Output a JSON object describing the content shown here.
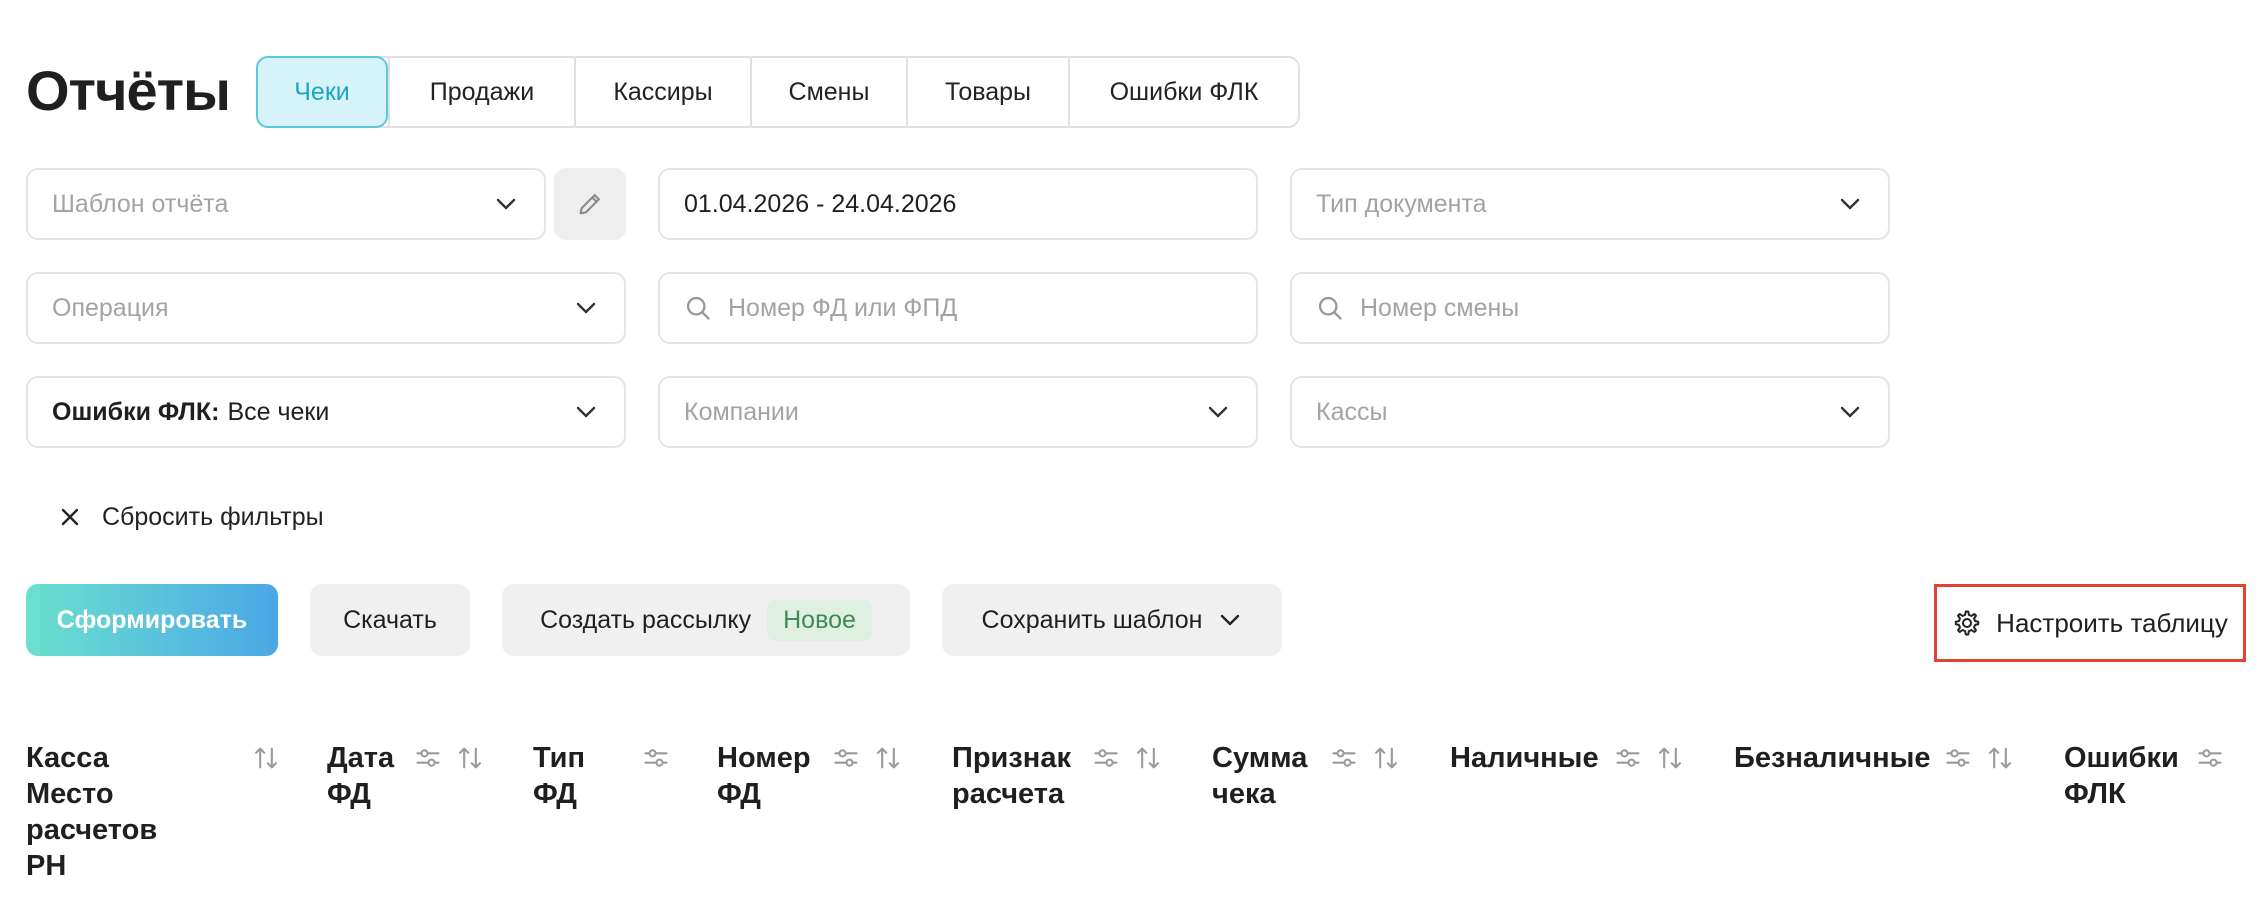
{
  "page_title": "Отчёты",
  "tabs": [
    {
      "label": "Чеки",
      "active": true
    },
    {
      "label": "Продажи"
    },
    {
      "label": "Кассиры"
    },
    {
      "label": "Смены"
    },
    {
      "label": "Товары"
    },
    {
      "label": "Ошибки ФЛК"
    }
  ],
  "filters": {
    "template_placeholder": "Шаблон отчёта",
    "date_range": "01.04.2026 - 24.04.2026",
    "doc_type_placeholder": "Тип документа",
    "operation_placeholder": "Операция",
    "fd_number_placeholder": "Номер ФД или ФПД",
    "shift_number_placeholder": "Номер смены",
    "flk_errors_label": "Ошибки ФЛК:",
    "flk_errors_value": "Все чеки",
    "companies_placeholder": "Компании",
    "cashboxes_placeholder": "Кассы",
    "reset_label": "Сбросить фильтры"
  },
  "actions": {
    "generate": "Сформировать",
    "download": "Скачать",
    "create_mailing": "Создать рассылку",
    "new_badge": "Новое",
    "save_template": "Сохранить шаблон",
    "configure_table": "Настроить таблицу"
  },
  "table": {
    "columns": [
      {
        "label": "Касса\nМесто\nрасчетов\nРН",
        "filter": false,
        "sort": true
      },
      {
        "label": "Дата\nФД",
        "filter": true,
        "sort": true
      },
      {
        "label": "Тип\nФД",
        "filter": true,
        "sort": false
      },
      {
        "label": "Номер\nФД",
        "filter": true,
        "sort": true
      },
      {
        "label": "Признак\nрасчета",
        "filter": true,
        "sort": true
      },
      {
        "label": "Сумма\nчека",
        "filter": true,
        "sort": true
      },
      {
        "label": "Наличные",
        "filter": true,
        "sort": true
      },
      {
        "label": "Безналичные",
        "filter": true,
        "sort": true
      },
      {
        "label": "Ошибки\nФЛК",
        "filter": true,
        "sort": false
      }
    ]
  },
  "colors": {
    "accent": "#1aa5c8",
    "highlight_border": "#e2432e",
    "primary_gradient_start": "#6be0cf",
    "primary_gradient_end": "#4aa7e6"
  }
}
